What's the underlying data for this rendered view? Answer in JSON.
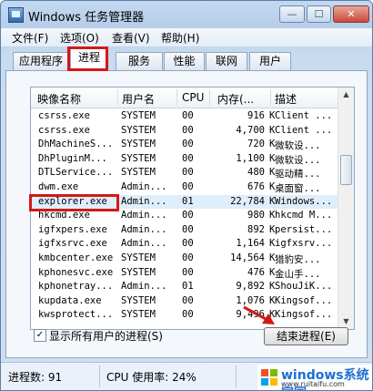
{
  "window": {
    "title": "Windows 任务管理器"
  },
  "controls": {
    "minimize": "—",
    "maximize": "☐",
    "close": "✕"
  },
  "menu": [
    "文件(F)",
    "选项(O)",
    "查看(V)",
    "帮助(H)"
  ],
  "tabs": [
    {
      "label": "应用程序",
      "active": false
    },
    {
      "label": "进程",
      "active": true
    },
    {
      "label": "服务",
      "active": false
    },
    {
      "label": "性能",
      "active": false
    },
    {
      "label": "联网",
      "active": false
    },
    {
      "label": "用户",
      "active": false
    }
  ],
  "columns": [
    "映像名称",
    "用户名",
    "CPU",
    "内存(...",
    "描述"
  ],
  "rows": [
    {
      "name": "csrss.exe",
      "user": "SYSTEM",
      "cpu": "00",
      "mem": "916",
      "unit": "K",
      "desc": "Client ...",
      "selected": false
    },
    {
      "name": "csrss.exe",
      "user": "SYSTEM",
      "cpu": "00",
      "mem": "4,700",
      "unit": "K",
      "desc": "Client ...",
      "selected": false
    },
    {
      "name": "DhMachineS...",
      "user": "SYSTEM",
      "cpu": "00",
      "mem": "720",
      "unit": "K",
      "desc": "微软设...",
      "selected": false
    },
    {
      "name": "DhPluginM...",
      "user": "SYSTEM",
      "cpu": "00",
      "mem": "1,100",
      "unit": "K",
      "desc": "微软设...",
      "selected": false
    },
    {
      "name": "DTLService...",
      "user": "SYSTEM",
      "cpu": "00",
      "mem": "480",
      "unit": "K",
      "desc": "驱动精...",
      "selected": false
    },
    {
      "name": "dwm.exe",
      "user": "Admin...",
      "cpu": "00",
      "mem": "676",
      "unit": "K",
      "desc": "桌面窗...",
      "selected": false
    },
    {
      "name": "explorer.exe",
      "user": "Admin...",
      "cpu": "01",
      "mem": "22,784",
      "unit": "K",
      "desc": "Windows...",
      "selected": true
    },
    {
      "name": "hkcmd.exe",
      "user": "Admin...",
      "cpu": "00",
      "mem": "980",
      "unit": "K",
      "desc": "hkcmd M...",
      "selected": false
    },
    {
      "name": "igfxpers.exe",
      "user": "Admin...",
      "cpu": "00",
      "mem": "892",
      "unit": "K",
      "desc": "persist...",
      "selected": false
    },
    {
      "name": "igfxsrvc.exe",
      "user": "Admin...",
      "cpu": "00",
      "mem": "1,164",
      "unit": "K",
      "desc": "igfxsrv...",
      "selected": false
    },
    {
      "name": "kmbcenter.exe",
      "user": "SYSTEM",
      "cpu": "00",
      "mem": "14,564",
      "unit": "K",
      "desc": "猎豹安...",
      "selected": false
    },
    {
      "name": "kphonesvc.exe",
      "user": "SYSTEM",
      "cpu": "00",
      "mem": "476",
      "unit": "K",
      "desc": "金山手...",
      "selected": false
    },
    {
      "name": "kphonetray...",
      "user": "Admin...",
      "cpu": "01",
      "mem": "9,892",
      "unit": "K",
      "desc": "ShouJiK...",
      "selected": false
    },
    {
      "name": "kupdata.exe",
      "user": "SYSTEM",
      "cpu": "00",
      "mem": "1,076",
      "unit": "K",
      "desc": "Kingsof...",
      "selected": false
    },
    {
      "name": "kwsprotect...",
      "user": "SYSTEM",
      "cpu": "00",
      "mem": "9,496",
      "unit": "K",
      "desc": "Kingsof...",
      "selected": false
    }
  ],
  "show_all": {
    "label": "显示所有用户的进程(S)",
    "checked": true,
    "mark": "✓"
  },
  "end_process": "结束进程(E)",
  "status": {
    "processes": "进程数: 91",
    "cpu": "CPU 使用率: 24%"
  },
  "watermark": {
    "text": "windows系统家园",
    "sub": "www.ruitaifu.com"
  },
  "colors": {
    "highlight": "#d31818",
    "selected_row": "#dfeefc"
  }
}
